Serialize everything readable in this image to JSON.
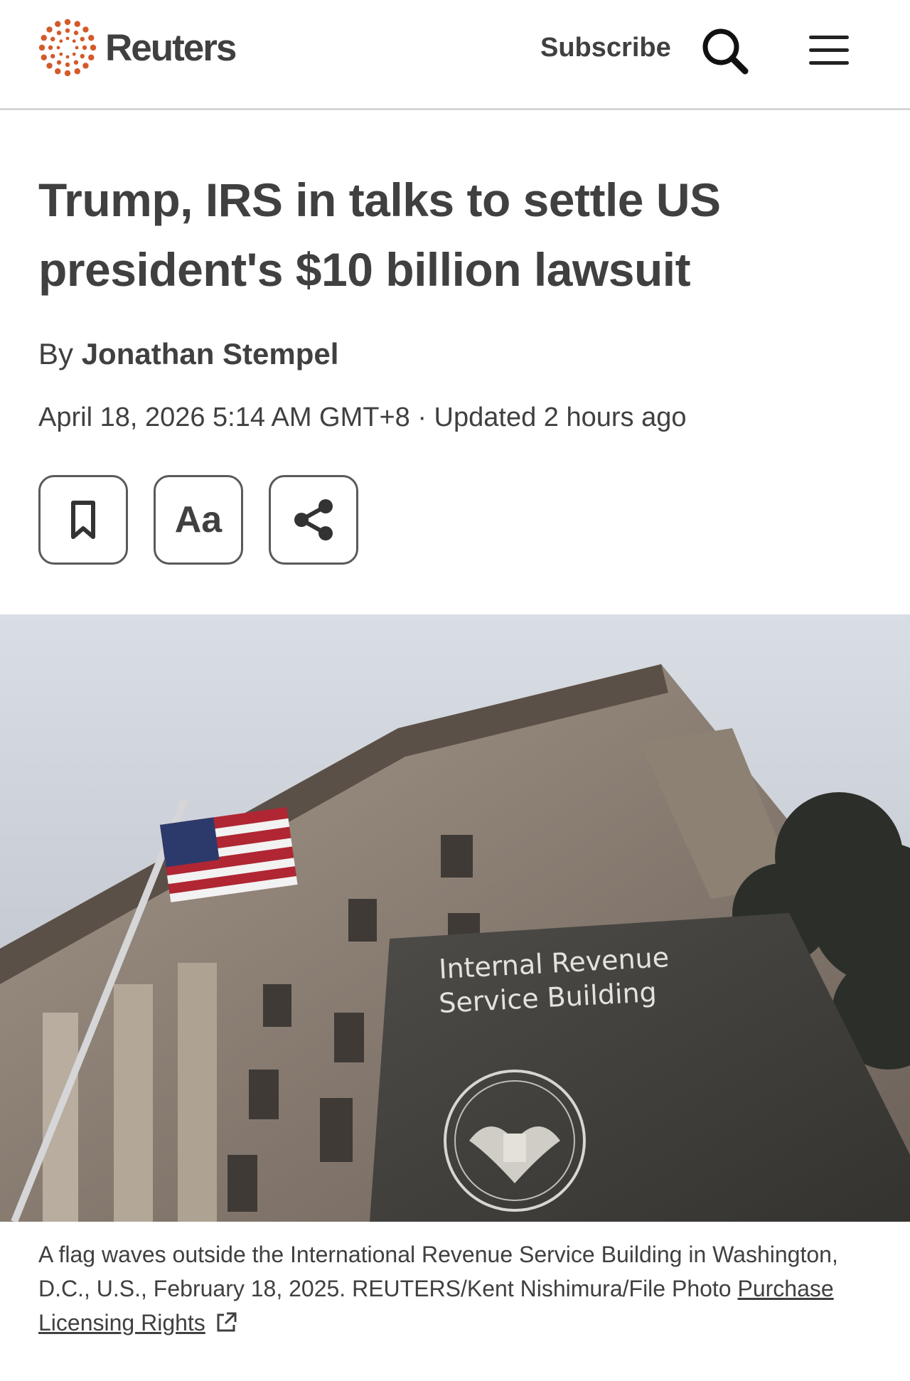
{
  "header": {
    "brand": "Reuters",
    "subscribe_label": "Subscribe",
    "search_icon": "search-icon",
    "menu_icon": "hamburger-menu-icon",
    "brand_color": "#d35a2a"
  },
  "article": {
    "headline": "Trump, IRS in talks to settle US president's $10 billion lawsuit",
    "byline_prefix": "By",
    "author": "Jonathan Stempel",
    "dateline": "April 18, 2026 5:14 AM GMT+8 · Updated 2 hours ago"
  },
  "actions": {
    "bookmark_icon": "bookmark-icon",
    "text_size_label": "Aa",
    "share_icon": "share-icon"
  },
  "photo": {
    "sign_line1": "Internal Revenue",
    "sign_line2": "Service Building"
  },
  "caption": {
    "text": "A flag waves outside the International Revenue Service Building in Washington, D.C., U.S., February 18, 2025. REUTERS/Kent Nishimura/File Photo",
    "link_label": "Purchase Licensing Rights",
    "link_icon": "external-link-icon"
  }
}
